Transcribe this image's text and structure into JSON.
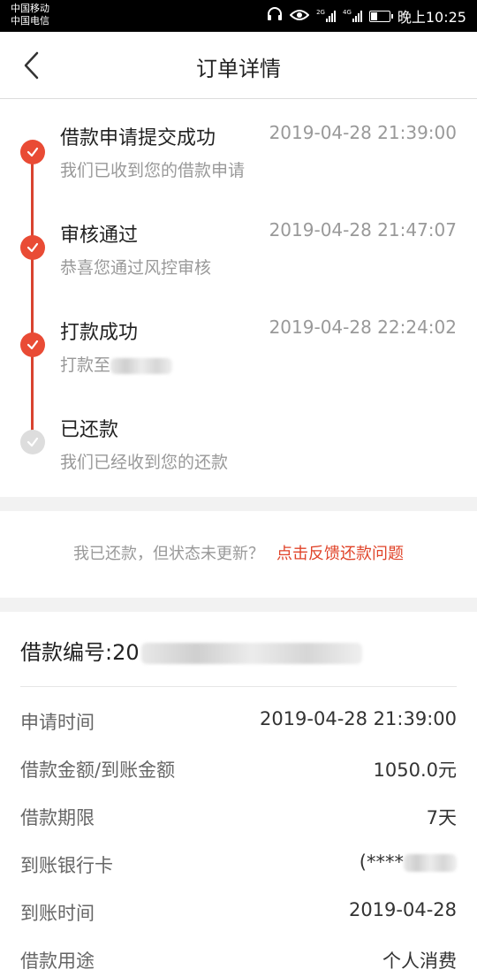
{
  "status_bar": {
    "carrier_1": "中国移动",
    "carrier_2": "中国电信",
    "network_2g": "2G",
    "network_4g": "4G",
    "time": "晚上10:25",
    "icons": [
      "headset-icon",
      "eye-icon",
      "signal-icon",
      "battery-icon"
    ]
  },
  "header": {
    "title": "订单详情",
    "back_icon": "chevron-left-icon"
  },
  "timeline": {
    "accent_color": "#e94b35",
    "inactive_color": "#dddddd",
    "steps": [
      {
        "title": "借款申请提交成功",
        "time": "2019-04-28 21:39:00",
        "desc": "我们已收到您的借款申请",
        "done": true
      },
      {
        "title": "审核通过",
        "time": "2019-04-28 21:47:07",
        "desc": "恭喜您通过风控审核",
        "done": true
      },
      {
        "title": "打款成功",
        "time": "2019-04-28 22:24:02",
        "desc": "打款至",
        "done": true
      },
      {
        "title": "已还款",
        "time": "",
        "desc": "我们已经收到您的还款",
        "done": false
      }
    ]
  },
  "feedback": {
    "question": "我已还款，但状态未更新？",
    "link": "点击反馈还款问题",
    "link_color": "#e0442a"
  },
  "details": {
    "loan_no_label": "借款编号:",
    "loan_no_prefix": "20",
    "rows": [
      {
        "label": "申请时间",
        "value": "2019-04-28 21:39:00"
      },
      {
        "label": "借款金额/到账金额",
        "value": "1050.0元"
      },
      {
        "label": "借款期限",
        "value": "7天"
      },
      {
        "label": "到账银行卡",
        "value": "(****"
      },
      {
        "label": "到账时间",
        "value": "2019-04-28"
      },
      {
        "label": "借款用途",
        "value": "个人消费"
      }
    ]
  }
}
